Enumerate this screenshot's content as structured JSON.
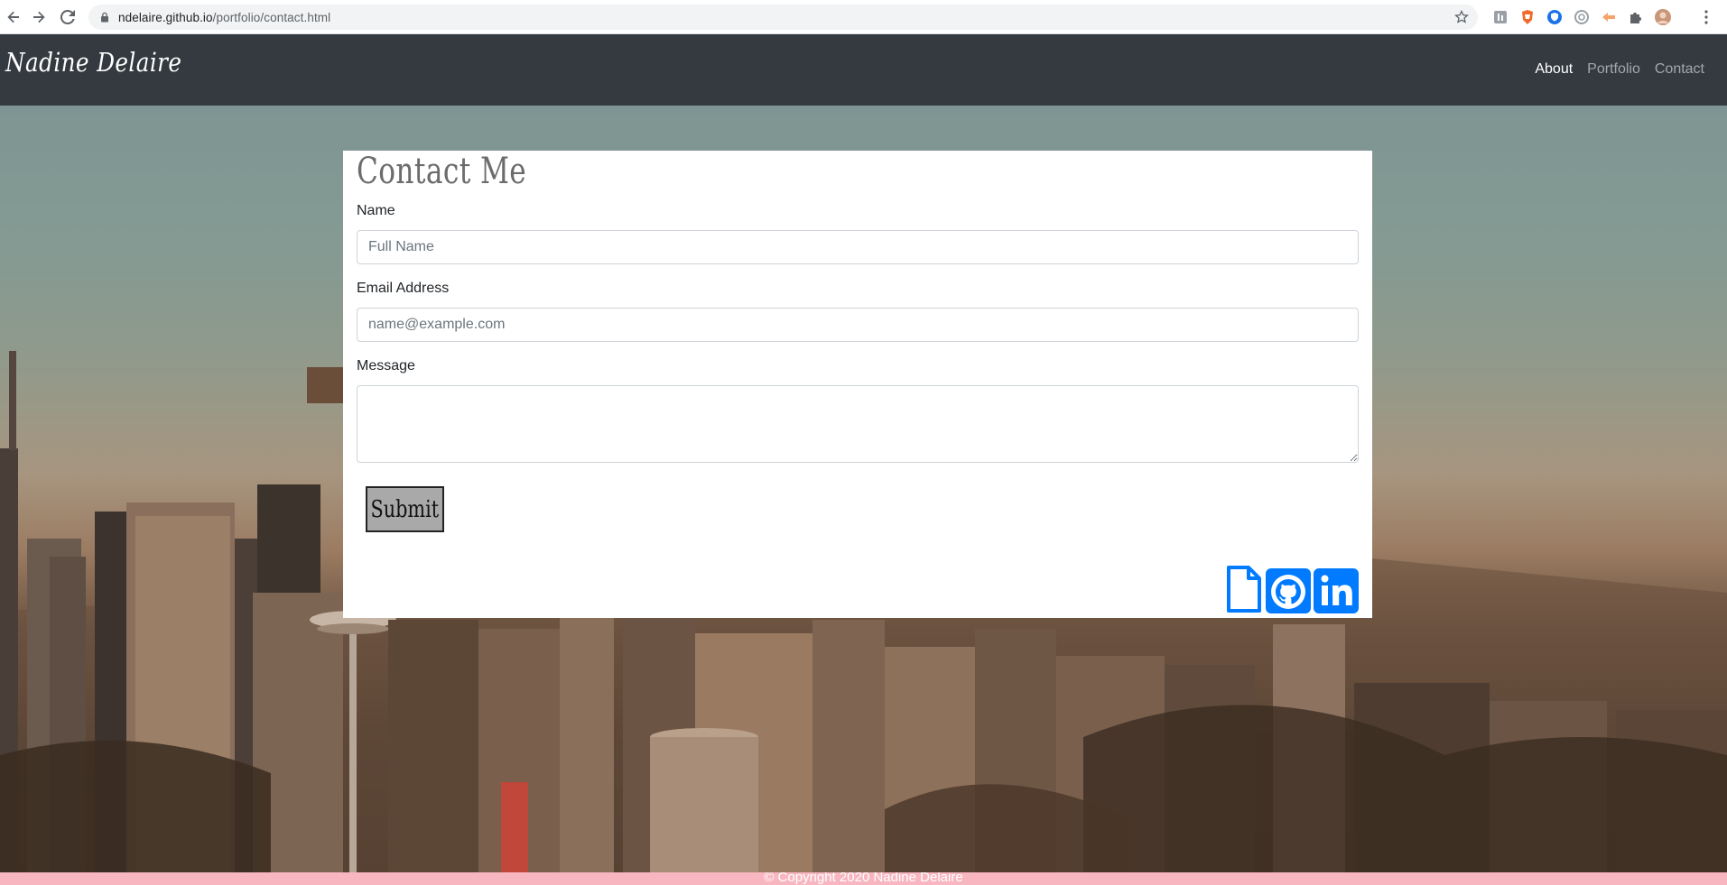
{
  "browser": {
    "url_host": "ndelaire.github.io",
    "url_path": "/portfolio/contact.html"
  },
  "site": {
    "brand": "Nadine Delaire",
    "nav": [
      {
        "label": "About",
        "active": true
      },
      {
        "label": "Portfolio",
        "active": false
      },
      {
        "label": "Contact",
        "active": false
      }
    ]
  },
  "contact": {
    "title": "Contact Me",
    "name_label": "Name",
    "name_placeholder": "Full Name",
    "email_label": "Email Address",
    "email_placeholder": "name@example.com",
    "message_label": "Message",
    "submit_label": "Submit"
  },
  "social_icons": [
    "resume-file-icon",
    "github-icon",
    "linkedin-icon"
  ],
  "footer": {
    "text": "© Copyright 2020 Nadine Delaire"
  },
  "colors": {
    "navbar_bg": "#343a40",
    "accent": "#007bff",
    "footer_bg": "#f8b7c0"
  }
}
